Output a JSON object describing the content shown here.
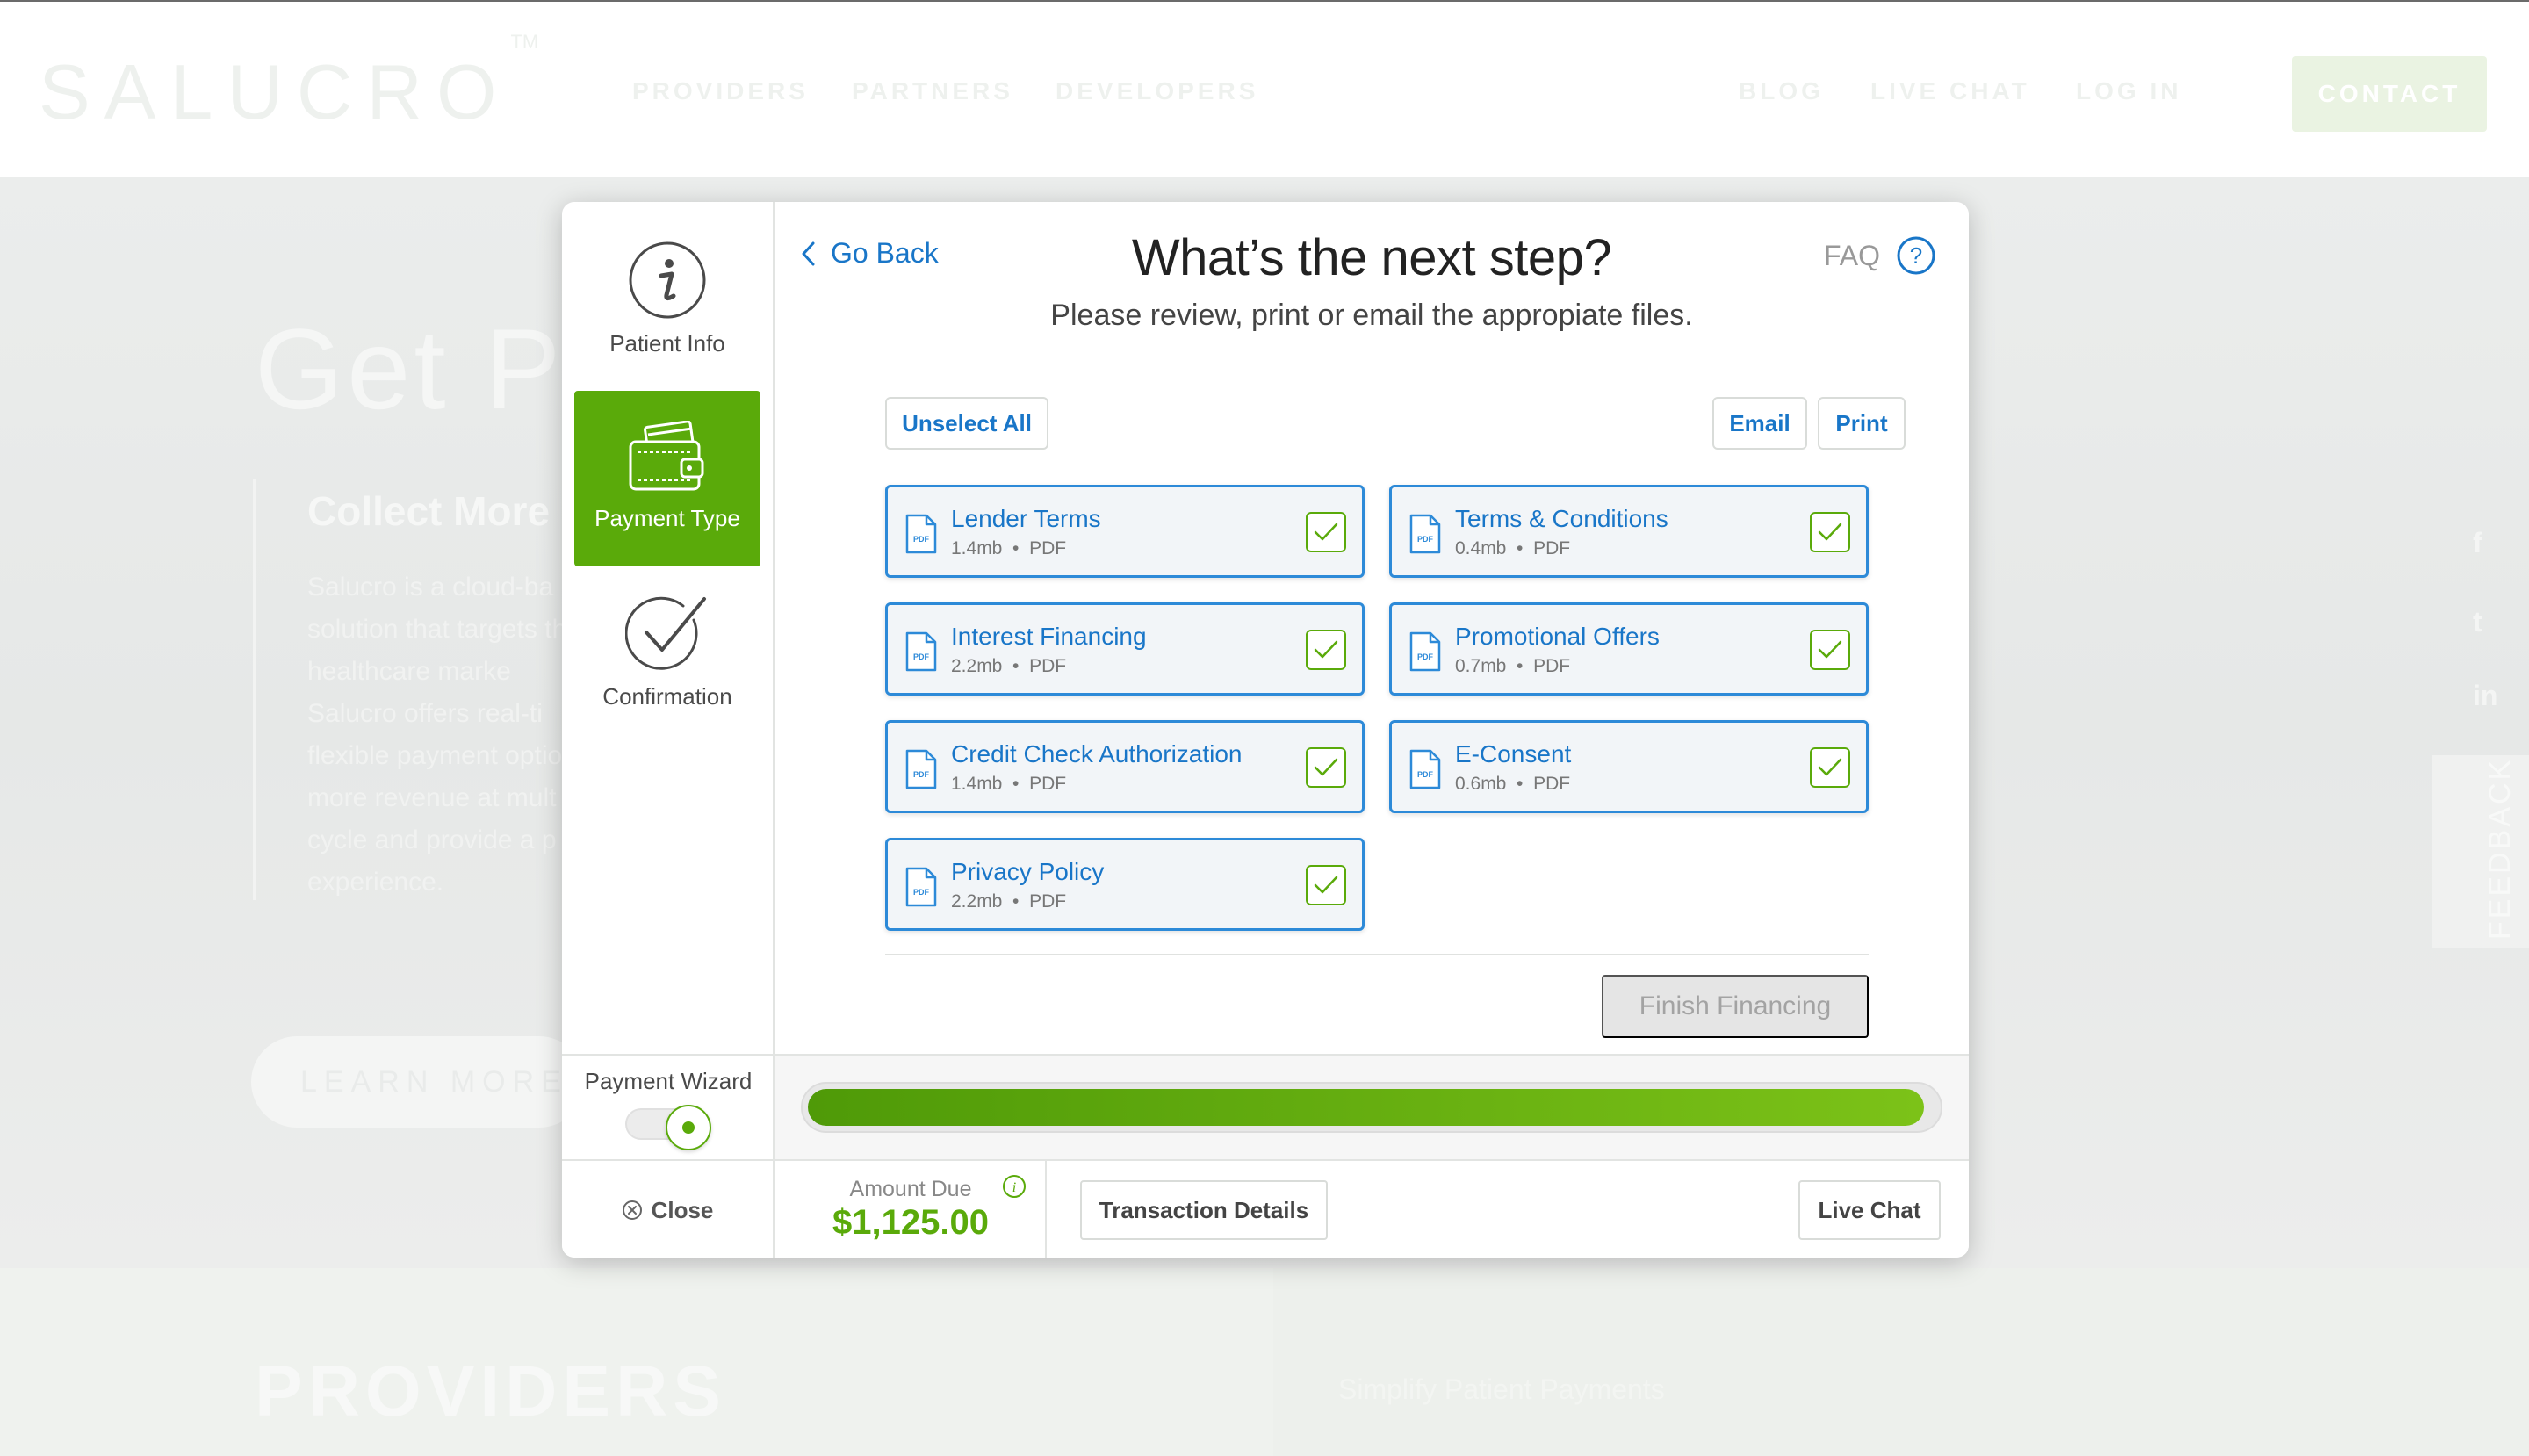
{
  "site": {
    "logo": "SALUCRO",
    "logo_tm": "TM",
    "nav_left": [
      "PROVIDERS",
      "PARTNERS",
      "DEVELOPERS"
    ],
    "nav_right": [
      "BLOG",
      "LIVE CHAT",
      "LOG IN"
    ],
    "contact_label": "CONTACT",
    "hero_title": "Get Pa",
    "hero_sub": "Collect More",
    "hero_body": "Salucro is a cloud-ba solution that targets the healthcare marke Salucro offers real-ti flexible payment optio more revenue at mult cycle and provide a p experience.",
    "learn_more": "LEARN MORE",
    "feedback": "FEEDBACK",
    "social": [
      "f",
      "t",
      "in"
    ],
    "providers_title": "PROVIDERS",
    "providers_sub": "Simplify Patient Payments"
  },
  "sidebar": {
    "steps": [
      {
        "label": "Patient Info",
        "icon": "info-circle-icon",
        "active": false
      },
      {
        "label": "Payment Type",
        "icon": "wallet-icon",
        "active": true
      },
      {
        "label": "Confirmation",
        "icon": "checkmark-circle-icon",
        "active": false
      }
    ],
    "wizard_label": "Payment Wizard",
    "wizard_on": true,
    "close_label": "Close"
  },
  "header": {
    "back_label": "Go Back",
    "title": "What’s the next step?",
    "subtitle": "Please review, print or email the appropiate files.",
    "faq_label": "FAQ",
    "faq_icon": "?"
  },
  "actions": {
    "unselect_all": "Unselect All",
    "email": "Email",
    "print": "Print",
    "finish": "Finish Financing"
  },
  "file_icon_text": "PDF",
  "files": [
    {
      "name": "Lender Terms",
      "size": "1.4mb",
      "type": "PDF",
      "checked": true
    },
    {
      "name": "Terms & Conditions",
      "size": "0.4mb",
      "type": "PDF",
      "checked": true
    },
    {
      "name": "Interest Financing",
      "size": "2.2mb",
      "type": "PDF",
      "checked": true
    },
    {
      "name": "Promotional Offers",
      "size": "0.7mb",
      "type": "PDF",
      "checked": true
    },
    {
      "name": "Credit Check Authorization",
      "size": "1.4mb",
      "type": "PDF",
      "checked": true
    },
    {
      "name": "E-Consent",
      "size": "0.6mb",
      "type": "PDF",
      "checked": true
    },
    {
      "name": "Privacy Policy",
      "size": "2.2mb",
      "type": "PDF",
      "checked": true
    }
  ],
  "meta_separator": "•",
  "progress": {
    "fraction": 0.99
  },
  "footer": {
    "amount_label": "Amount Due",
    "amount_value": "$1,125.00",
    "info_icon": "i",
    "transaction_details": "Transaction Details",
    "live_chat": "Live Chat"
  },
  "colors": {
    "accent_green": "#5aaa0a",
    "link_blue": "#1976c8",
    "card_border": "#2d8ad8"
  }
}
